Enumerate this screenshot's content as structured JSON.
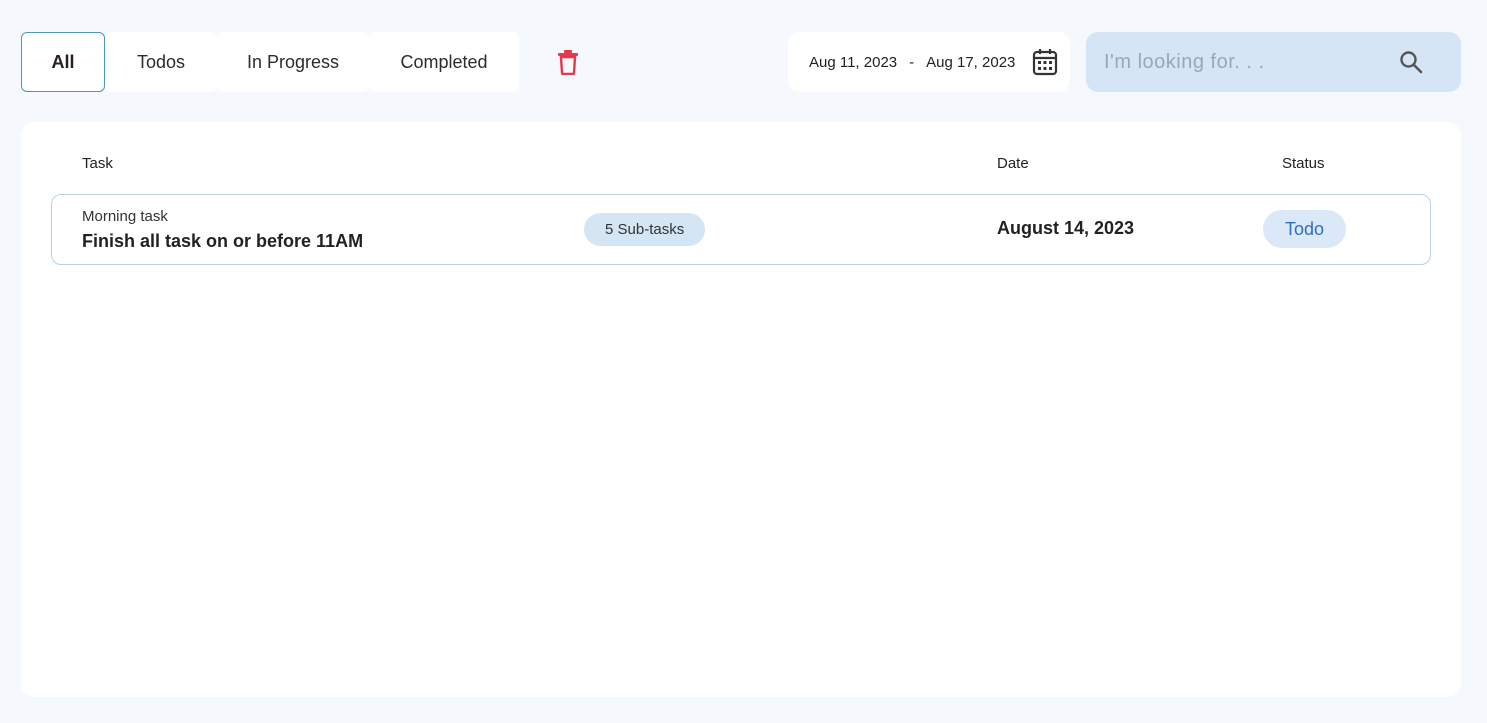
{
  "filters": {
    "tabs": [
      {
        "label": "All",
        "active": true
      },
      {
        "label": "Todos",
        "active": false
      },
      {
        "label": "In Progress",
        "active": false
      },
      {
        "label": "Completed",
        "active": false
      }
    ],
    "delete_icon": "trash-icon"
  },
  "date_range": {
    "start": "Aug 11, 2023",
    "separator": "-",
    "end": "Aug 17, 2023",
    "icon": "calendar-icon"
  },
  "search": {
    "placeholder": "I'm looking for. . .",
    "value": "",
    "icon": "search-icon"
  },
  "table": {
    "columns": {
      "task": "Task",
      "date": "Date",
      "status": "Status"
    },
    "rows": [
      {
        "category": "Morning task",
        "title": "Finish all task on or before 11AM",
        "subtasks": "5 Sub-tasks",
        "date": "August 14, 2023",
        "status": "Todo"
      }
    ]
  },
  "colors": {
    "background": "#f5f9fe",
    "accent_border": "#4a97c2",
    "delete": "#e5384b",
    "search_bg": "#d5e5f5",
    "status_bg": "#dbe8f8",
    "status_text": "#2f6fc0"
  }
}
